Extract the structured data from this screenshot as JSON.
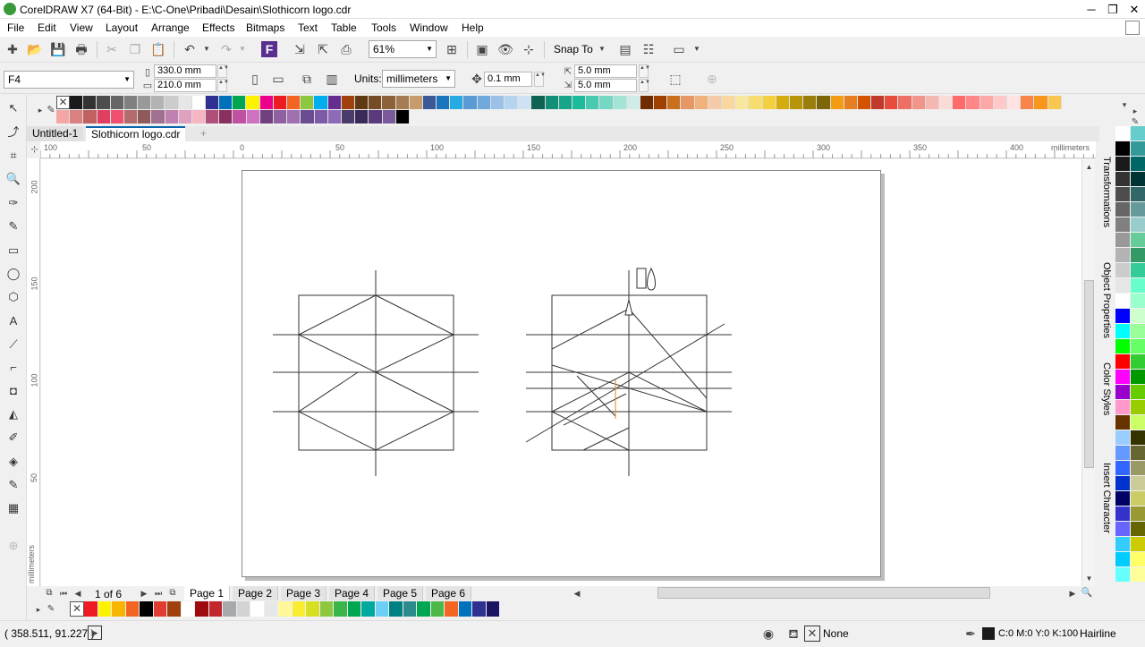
{
  "window": {
    "title": "CorelDRAW X7 (64-Bit) - E:\\C-One\\Pribadi\\Desain\\Slothicorn logo.cdr",
    "minimize": "─",
    "restore": "❐",
    "close": "✕"
  },
  "menu": [
    "File",
    "Edit",
    "View",
    "Layout",
    "Arrange",
    "Effects",
    "Bitmaps",
    "Text",
    "Table",
    "Tools",
    "Window",
    "Help"
  ],
  "toolbar": {
    "zoom": "61%",
    "snap_to": "Snap To"
  },
  "propbar": {
    "page_size": "F4",
    "width": "330.0 mm",
    "height": "210.0 mm",
    "units_label": "Units:",
    "units": "millimeters",
    "nudge": "0.1 mm",
    "dup_x": "5.0 mm",
    "dup_y": "5.0 mm"
  },
  "tabs": [
    "Untitled-1",
    "Slothicorn logo.cdr"
  ],
  "ruler": {
    "unit_label": "millimeters",
    "h_ticks": [
      "100",
      "50",
      "0",
      "50",
      "100",
      "150",
      "200",
      "250",
      "300",
      "350",
      "400"
    ],
    "v_ticks": [
      "200",
      "150",
      "100",
      "50"
    ]
  },
  "dockers": [
    "Transformations",
    "Object Properties",
    "Color Styles",
    "Insert Character"
  ],
  "pages": {
    "counter": "1 of 6",
    "tabs": [
      "Page 1",
      "Page 2",
      "Page 3",
      "Page 4",
      "Page 5",
      "Page 6"
    ]
  },
  "status": {
    "coords": "( 358.511, 91.227 )",
    "fill": "None",
    "outline_color": "C:0 M:0 Y:0 K:100",
    "outline_width": "Hairline"
  },
  "colors": {
    "palette_top_row1": [
      "#1a1a1a",
      "#333333",
      "#4d4d4d",
      "#666666",
      "#808080",
      "#999999",
      "#b3b3b3",
      "#cccccc",
      "#e6e6e6",
      "#ffffff",
      "#2e3192",
      "#0072bc",
      "#00a651",
      "#fff200",
      "#ec008c",
      "#ed1c24",
      "#f26522",
      "#8dc63f",
      "#00aeef",
      "#662d91",
      "#a0410d",
      "#603913",
      "#754c24",
      "#8c6239",
      "#a67c52",
      "#c69c6d",
      "#3b5998",
      "#1b75bc",
      "#27aae1",
      "#5b9bd5",
      "#70a9dc",
      "#9bc2e6",
      "#b4d4ef",
      "#cfe2f3",
      "#0e6251",
      "#148f77",
      "#17a589",
      "#1abc9c",
      "#48c9b0",
      "#76d7c4",
      "#a3e4d7",
      "#d0ece7",
      "#6e2c00",
      "#a04000",
      "#ca6f1e",
      "#e59866",
      "#f0b27a",
      "#f5cba7",
      "#fad7a0",
      "#f9e79f",
      "#f7dc6f",
      "#f4d03f",
      "#d4ac0d",
      "#b7950b",
      "#9a7d0a",
      "#7d6608",
      "#f39c12",
      "#e67e22",
      "#d35400",
      "#c0392b",
      "#e74c3c",
      "#ec7063",
      "#f1948a",
      "#f5b7b1",
      "#fadbd8",
      "#ff6b6b",
      "#ff8787",
      "#ffa8a8",
      "#ffc9c9",
      "#ffe3e3",
      "#f9844a",
      "#f8961e",
      "#f9c74f"
    ],
    "palette_top_row2": [
      "#f4a6a6",
      "#d98080",
      "#c06060",
      "#e04060",
      "#f05070",
      "#b36b6b",
      "#8e5a5a",
      "#a07090",
      "#c080b0",
      "#e0a0c0",
      "#f4b6c2",
      "#b0507a",
      "#8a3060",
      "#c050a0",
      "#d070c0",
      "#704080",
      "#9060a0",
      "#a070b0",
      "#6a4c93",
      "#7d5ba6",
      "#8e6bb8",
      "#4b3b6b",
      "#3a2a5a",
      "#5a3a7a",
      "#7a5a9a",
      "#000000"
    ],
    "right_palette_a": [
      "#ffffff",
      "#000000",
      "#1a1a1a",
      "#333333",
      "#4d4d4d",
      "#666666",
      "#808080",
      "#999999",
      "#b3b3b3",
      "#cccccc",
      "#e6e6e6",
      "#ffffff",
      "#0000ff",
      "#00ffff",
      "#00ff00",
      "#ff0000",
      "#ff00ff",
      "#9900cc",
      "#ff99cc",
      "#663300",
      "#99ccff",
      "#6699ff",
      "#3366ff",
      "#0033cc",
      "#000066",
      "#3333cc",
      "#6666ff",
      "#33ccff",
      "#00ccff",
      "#66ffff"
    ],
    "right_palette_b": [
      "#66cccc",
      "#339999",
      "#006666",
      "#003333",
      "#336666",
      "#669999",
      "#99cccc",
      "#66cc99",
      "#339966",
      "#33cc99",
      "#66ffcc",
      "#99ffcc",
      "#ccffcc",
      "#99ff99",
      "#66ff66",
      "#33cc33",
      "#009900",
      "#66cc00",
      "#99cc00",
      "#ccff66",
      "#333300",
      "#666633",
      "#999966",
      "#cccc99",
      "#cccc66",
      "#999933",
      "#666600",
      "#cccc00",
      "#ffff66",
      "#ffff99"
    ],
    "doc_palette": [
      "#ed1c24",
      "#fff200",
      "#f7b500",
      "#f26522",
      "#000000",
      "#e03c31",
      "#a0410d",
      "#ffffff",
      "#9e0b0f",
      "#c1272d",
      "#a7a9ac",
      "#d1d3d4",
      "#ffffff",
      "#e6e7e8",
      "#fff799",
      "#f9ed32",
      "#d7df23",
      "#8dc63f",
      "#39b54a",
      "#00a651",
      "#00a99d",
      "#6dcff6",
      "#008080",
      "#2b8c8c",
      "#00a651",
      "#4cb848",
      "#f26522",
      "#0072bc",
      "#2e3192",
      "#1b1464"
    ],
    "page_bg": "#ffffff",
    "accent": "#0a64ad"
  }
}
